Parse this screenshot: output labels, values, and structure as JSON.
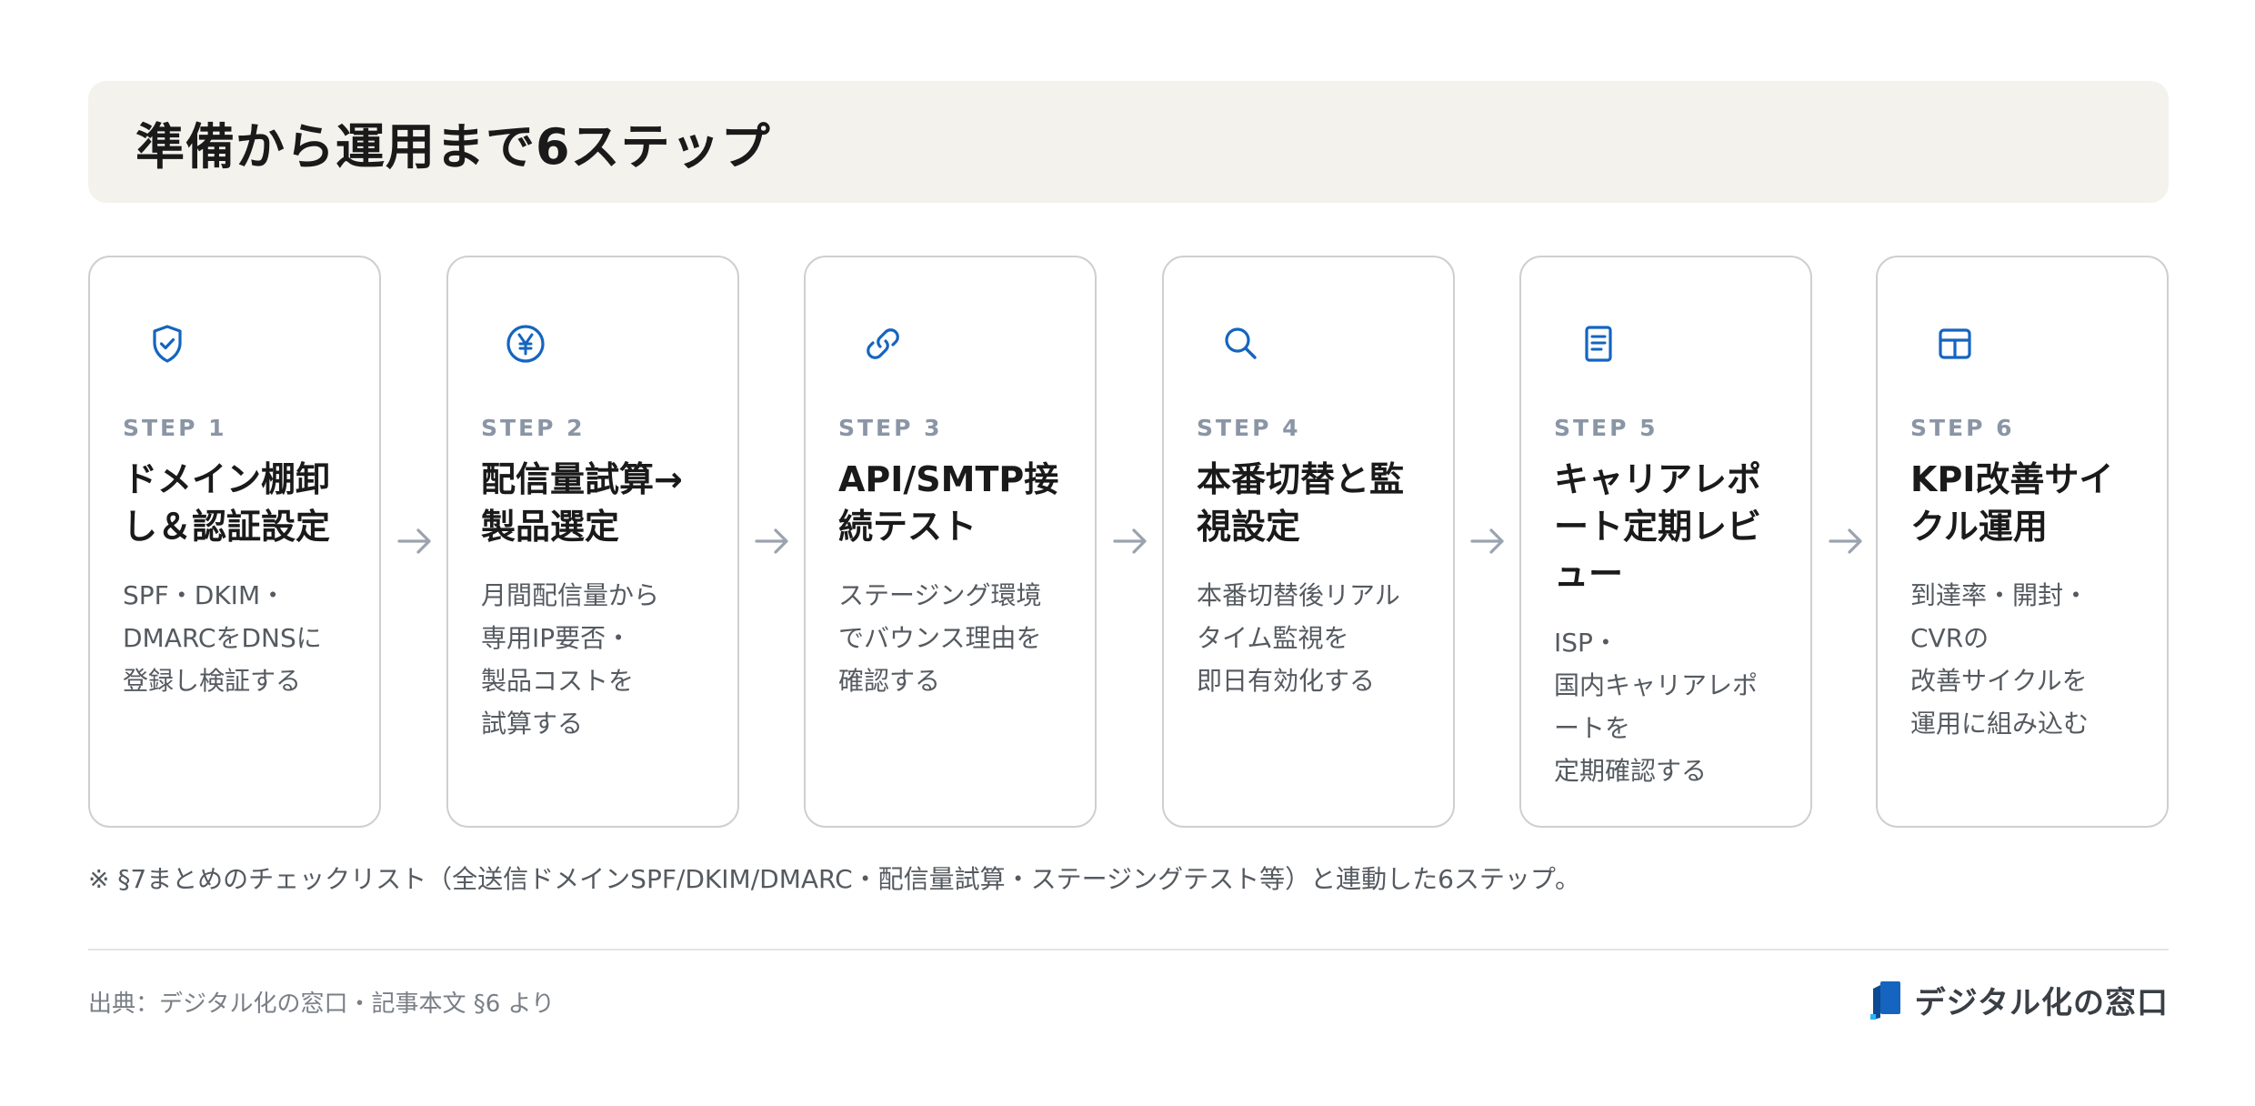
{
  "title": "準備から運用まで6ステップ",
  "colors": {
    "accent": "#1565c0",
    "step_label": "#8a95a5",
    "arrow": "#9aa3ae",
    "banner_bg": "#f4f2ec"
  },
  "steps": [
    {
      "label": "STEP 1",
      "title": "ドメイン棚卸し＆認証設定",
      "desc": "SPF・DKIM・\nDMARCをDNSに\n登録し検証する",
      "icon": "shield-check-icon"
    },
    {
      "label": "STEP 2",
      "title": "配信量試算→製品選定",
      "desc": "月間配信量から\n専用IP要否・\n製品コストを\n試算する",
      "icon": "yen-icon"
    },
    {
      "label": "STEP 3",
      "title": "API/SMTP接続テスト",
      "desc": "ステージング環境\nでバウンス理由を\n確認する",
      "icon": "link-icon"
    },
    {
      "label": "STEP 4",
      "title": "本番切替と監視設定",
      "desc": "本番切替後リアル\nタイム監視を\n即日有効化する",
      "icon": "search-icon"
    },
    {
      "label": "STEP 5",
      "title": "キャリアレポート定期レビュー",
      "desc": "ISP・\n国内キャリアレポ\nートを\n定期確認する",
      "icon": "document-icon"
    },
    {
      "label": "STEP 6",
      "title": "KPI改善サイクル運用",
      "desc": "到達率・開封・\nCVRの\n改善サイクルを\n運用に組み込む",
      "icon": "table-icon"
    }
  ],
  "note": "※ §7まとめのチェックリスト（全送信ドメインSPF/DKIM/DMARC・配信量試算・ステージングテスト等）と連動した6ステップ。",
  "source": "出典：デジタル化の窓口・記事本文 §6 より",
  "logo_text": "デジタル化の窓口"
}
